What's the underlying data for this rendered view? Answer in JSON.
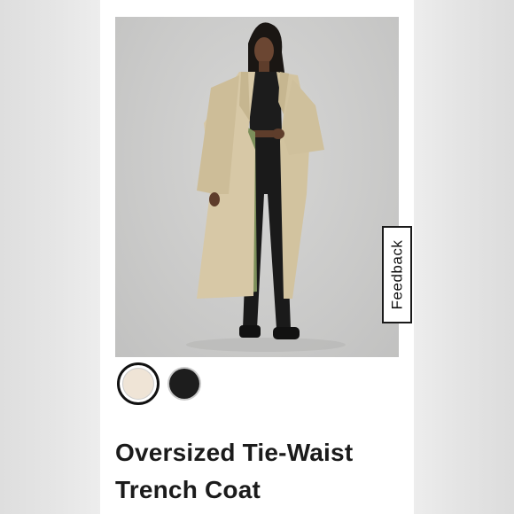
{
  "product": {
    "title": "Oversized Tie-Waist Trench Coat",
    "image_alt": "Model wearing oversized trench coat"
  },
  "feedback_tab": {
    "label": "Feedback"
  },
  "swatches": [
    {
      "name": "trench",
      "color": "#efe4d6",
      "selected": true
    },
    {
      "name": "black",
      "color": "#1d1d1d",
      "selected": false
    }
  ],
  "colors": {
    "accent": "#111111",
    "background": "#ffffff",
    "coat": "#d7c8a6",
    "lining": "#7c8f5a"
  }
}
